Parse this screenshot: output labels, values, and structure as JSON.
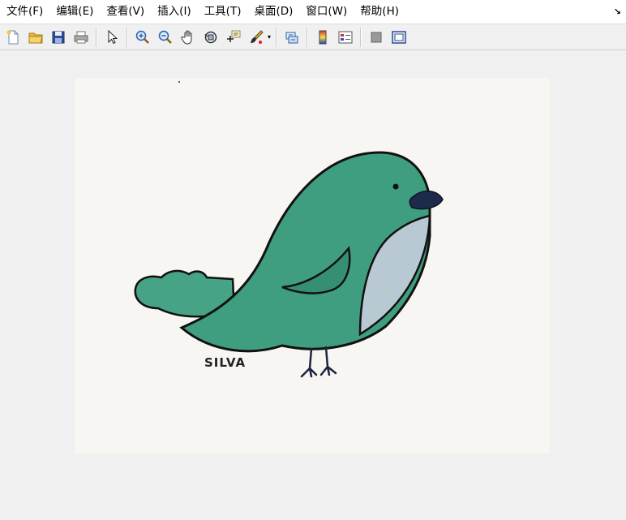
{
  "menu": {
    "items": [
      "文件(F)",
      "编辑(E)",
      "查看(V)",
      "插入(I)",
      "工具(T)",
      "桌面(D)",
      "窗口(W)",
      "帮助(H)"
    ],
    "corner": "↘"
  },
  "toolbar": {
    "buttons": [
      "new-file-icon",
      "open-folder-icon",
      "save-icon",
      "print-icon",
      "pointer-icon",
      "zoom-in-icon",
      "zoom-out-icon",
      "pan-hand-icon",
      "rotate-3d-icon",
      "data-cursor-icon",
      "brush-icon",
      "link-plot-icon",
      "colorbar-icon",
      "legend-icon",
      "hide-plot-tools-icon",
      "show-plot-tools-icon"
    ]
  },
  "image": {
    "signature": "SILVA",
    "colors": {
      "body": "#3f9e80",
      "belly": "#b9c9d3",
      "beak": "#1d2a4a",
      "paper": "#f7f6f2",
      "outline": "#111111"
    }
  }
}
